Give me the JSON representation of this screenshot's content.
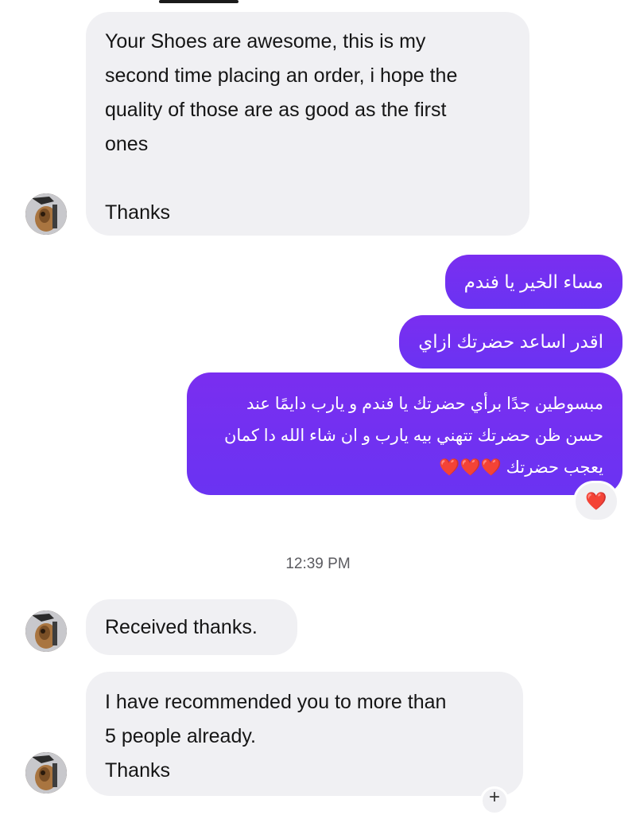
{
  "conversation": {
    "messages": [
      {
        "id": "m1",
        "direction": "incoming",
        "lines": [
          "Your Shoes are awesome, this is my",
          "second time placing an order, i hope the",
          "quality of those are as good as the first",
          "ones",
          "",
          "Thanks"
        ]
      },
      {
        "id": "m2",
        "direction": "outgoing",
        "lines": [
          "مساء الخير يا فندم"
        ]
      },
      {
        "id": "m3",
        "direction": "outgoing",
        "lines": [
          "اقدر اساعد حضرتك ازاي"
        ]
      },
      {
        "id": "m4",
        "direction": "outgoing",
        "lines": [
          "مبسوطين جدًا برأي حضرتك يا فندم و يارب دايمًا عند",
          "حسن ظن حضرتك تتهني بيه يارب و ان شاء الله دا كمان",
          "يعجب حضرتك ❤️❤️❤️"
        ],
        "reaction": "❤️"
      },
      {
        "id": "m5",
        "direction": "incoming",
        "lines": [
          "Received thanks."
        ]
      },
      {
        "id": "m6",
        "direction": "incoming",
        "lines": [
          "I have recommended you to more than",
          "5 people already.",
          "Thanks"
        ]
      }
    ],
    "timestamp": "12:39 PM",
    "add_reaction_symbol": "+"
  },
  "colors": {
    "outgoing_bubble": "#6a33f2",
    "incoming_bubble": "#f0f0f3",
    "reaction_heart": "#e0202a"
  }
}
